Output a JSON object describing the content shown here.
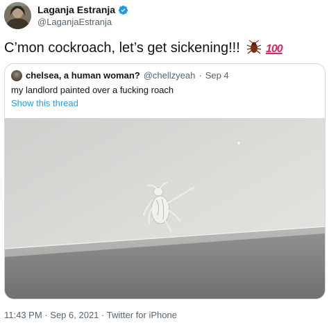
{
  "author": {
    "display_name": "Laganja Estranja",
    "handle": "@LaganjaEstranja",
    "verified": true,
    "avatar_icon": "profile-photo"
  },
  "tweet": {
    "text": "C’mon cockroach, let’s get sickening!!!",
    "emojis": [
      "cockroach-emoji",
      "hundred-points-emoji"
    ],
    "hundred_label": "100"
  },
  "quoted_tweet": {
    "display_name": "chelsea, a human woman?",
    "handle": "@chellzyeah",
    "separator": "·",
    "date": "Sep 4",
    "text": "my landlord painted over a fucking roach",
    "show_thread_label": "Show this thread"
  },
  "footer": {
    "time": "11:43 PM",
    "date": "Sep 6, 2021",
    "source": "Twitter for iPhone",
    "separator": "·"
  },
  "colors": {
    "link": "#1d9bf0",
    "secondary_text": "#536471",
    "primary_text": "#0f1419",
    "border": "#cfd9de",
    "verified": "#1d9bf0"
  }
}
